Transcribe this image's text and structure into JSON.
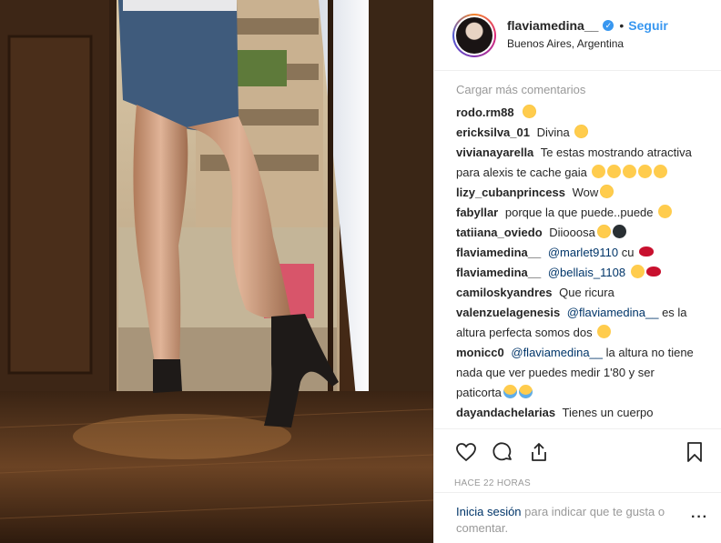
{
  "post": {
    "username": "flaviamedina__",
    "verified": true,
    "follow_label": "Seguir",
    "location": "Buenos Aires, Argentina",
    "load_more": "Cargar más comentarios",
    "time_ago": "HACE 22 HORAS",
    "login_link": "Inicia sesión",
    "login_text": "para indicar que te gusta o comentar."
  },
  "comments": [
    {
      "user": "rodo.rm88",
      "text": "",
      "emojis": [
        "star-struck"
      ]
    },
    {
      "user": "ericksilva_01",
      "text": "Divina",
      "emojis": [
        "star-struck"
      ]
    },
    {
      "user": "vivianayarella",
      "text": "Te estas mostrando atractiva para alexis te cache gaia",
      "emojis": [
        "smile",
        "smile",
        "smile",
        "smile",
        "smile"
      ]
    },
    {
      "user": "lizy_cubanprincess",
      "text": "Wow",
      "emojis": [
        "star-struck"
      ]
    },
    {
      "user": "fabyllar",
      "text": "porque la que puede..puede",
      "emojis": [
        "smile"
      ]
    },
    {
      "user": "tatiiana_oviedo",
      "text": "Diiooosa",
      "emojis": [
        "star-struck",
        "bomb"
      ]
    },
    {
      "user": "flaviamedina__",
      "mention": "@marlet9110",
      "text": "cu",
      "emojis": [
        "lips"
      ]
    },
    {
      "user": "flaviamedina__",
      "mention": "@bellais_1108",
      "text": "",
      "emojis": [
        "smile",
        "lips"
      ]
    },
    {
      "user": "camiloskyandres",
      "text": "Que ricura",
      "emojis": []
    },
    {
      "user": "valenzuelagenesis",
      "mention": "@flaviamedina__",
      "text": "es la altura perfecta somos dos",
      "emojis": [
        "smile"
      ]
    },
    {
      "user": "monicc0",
      "mention": "@flaviamedina__",
      "text": "la altura no tiene nada que ver puedes medir 1'80 y ser paticorta",
      "emojis": [
        "laugh",
        "laugh"
      ]
    },
    {
      "user": "dayandachelarias",
      "text": "Tienes un cuerpo",
      "emojis": []
    }
  ],
  "icons": {
    "like": "heart-icon",
    "comment": "comment-icon",
    "share": "share-icon",
    "save": "bookmark-icon",
    "more": "more-options-icon"
  },
  "colors": {
    "link": "#003569",
    "accent": "#3897f0",
    "muted": "#999999"
  }
}
